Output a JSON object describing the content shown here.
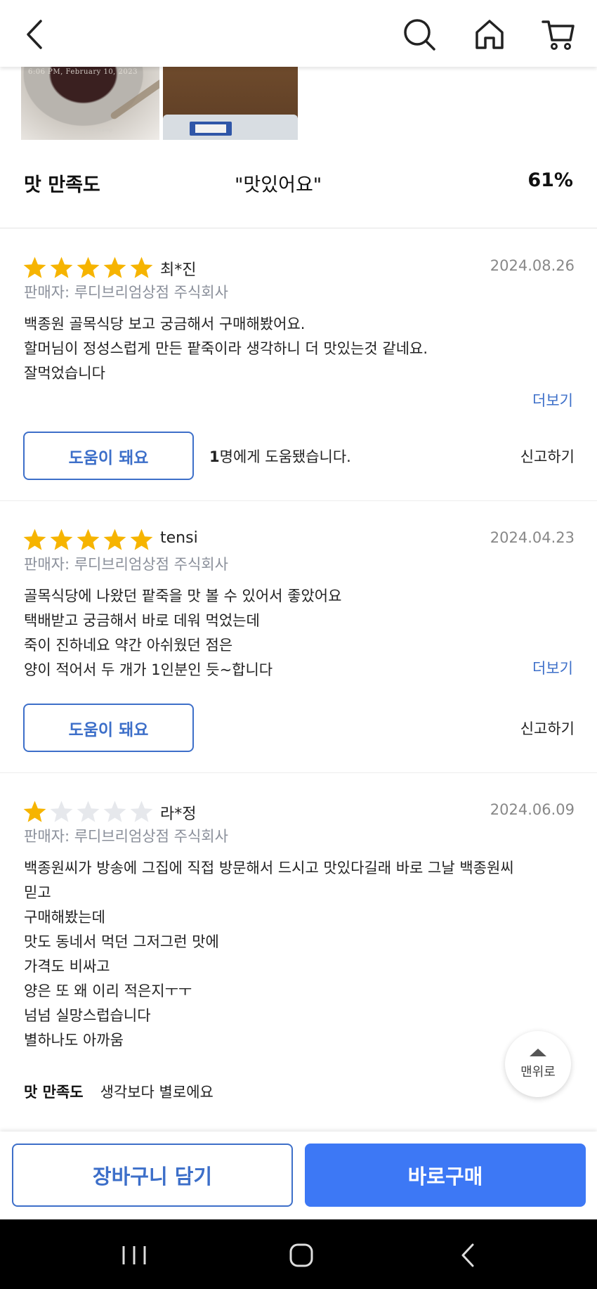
{
  "topbar": {
    "icons": [
      "back-arrow-icon",
      "search-icon",
      "home-icon",
      "cart-icon"
    ]
  },
  "photos": {
    "photo1_timestamp": "6:06 PM, February 10, 2023",
    "photo1_stamp": "Time Stamp"
  },
  "satisfaction": {
    "label": "맛 만족도",
    "value": "\"맛있어요\"",
    "percent": "61%"
  },
  "reviews": [
    {
      "rating": 5,
      "author": "최*진",
      "date": "2024.08.26",
      "seller": "판매자: 루디브리엄상점 주식회사",
      "lines": [
        "백종원 골목식당 보고 궁금해서 구매해봤어요.",
        "할머님이 정성스럽게 만든 팥죽이라 생각하니 더 맛있는것 같네요.",
        "잘먹었습니다"
      ],
      "more": "더보기",
      "help_button": "도움이 돼요",
      "help_count": "1",
      "help_text": "명에게 도움됐습니다.",
      "report": "신고하기"
    },
    {
      "rating": 5,
      "author": "tensi",
      "date": "2024.04.23",
      "seller": "판매자: 루디브리엄상점 주식회사",
      "lines": [
        "골목식당에 나왔던 팥죽을 맛 볼 수 있어서 좋았어요",
        "택배받고 궁금해서 바로 데워 먹었는데",
        "죽이 진하네요 약간 아쉬웠던 점은",
        "양이 적어서 두 개가 1인분인 듯~합니다"
      ],
      "more": "더보기",
      "help_button": "도움이 돼요",
      "report": "신고하기"
    },
    {
      "rating": 1,
      "author": "라*정",
      "date": "2024.06.09",
      "seller": "판매자: 루디브리엄상점 주식회사",
      "lines": [
        "백종원씨가 방송에 그집에 직접 방문해서 드시고 맛있다길래 바로 그날 백종원씨",
        "믿고",
        "구매해봤는데",
        "맛도 동네서 먹던 그저그런 맛에",
        "가격도 비싸고",
        "양은 또 왜 이리 적은지ㅜㅜ",
        "넘넘 실망스럽습니다",
        "별하나도 아까움"
      ],
      "satisfaction_label": "맛 만족도",
      "satisfaction_value": "생각보다 별로에요"
    }
  ],
  "scroll_top": {
    "label": "맨위로"
  },
  "actions": {
    "cart_button": "장바구니 담기",
    "buy_button": "바로구매"
  },
  "colors": {
    "accent": "#3d6fc9",
    "buy": "#3d78f5",
    "star_filled": "#f6b400",
    "star_empty": "#e6e8ec"
  }
}
